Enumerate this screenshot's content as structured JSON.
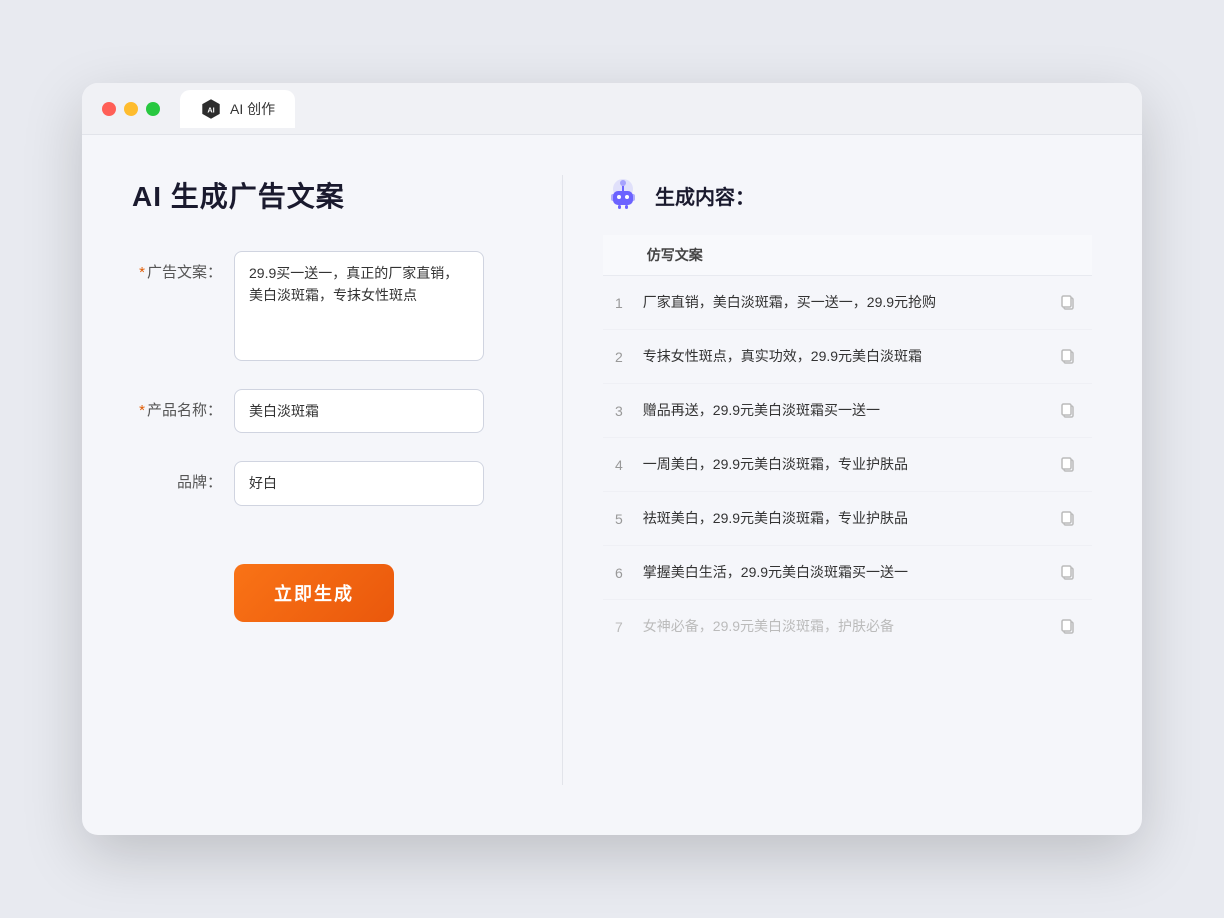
{
  "window": {
    "tab_label": "AI 创作"
  },
  "left_panel": {
    "title": "AI 生成广告文案",
    "form": {
      "ad_copy_label": "广告文案：",
      "ad_copy_required": true,
      "ad_copy_value": "29.9买一送一，真正的厂家直销，美白淡斑霜，专抹女性斑点",
      "product_name_label": "产品名称：",
      "product_name_required": true,
      "product_name_value": "美白淡斑霜",
      "brand_label": "品牌：",
      "brand_required": false,
      "brand_value": "好白"
    },
    "generate_button": "立即生成"
  },
  "right_panel": {
    "title": "生成内容：",
    "table_header": "仿写文案",
    "results": [
      {
        "num": "1",
        "text": "厂家直销，美白淡斑霜，买一送一，29.9元抢购",
        "faded": false
      },
      {
        "num": "2",
        "text": "专抹女性斑点，真实功效，29.9元美白淡斑霜",
        "faded": false
      },
      {
        "num": "3",
        "text": "赠品再送，29.9元美白淡斑霜买一送一",
        "faded": false
      },
      {
        "num": "4",
        "text": "一周美白，29.9元美白淡斑霜，专业护肤品",
        "faded": false
      },
      {
        "num": "5",
        "text": "祛斑美白，29.9元美白淡斑霜，专业护肤品",
        "faded": false
      },
      {
        "num": "6",
        "text": "掌握美白生活，29.9元美白淡斑霜买一送一",
        "faded": false
      },
      {
        "num": "7",
        "text": "女神必备，29.9元美白淡斑霜，护肤必备",
        "faded": true
      }
    ]
  }
}
